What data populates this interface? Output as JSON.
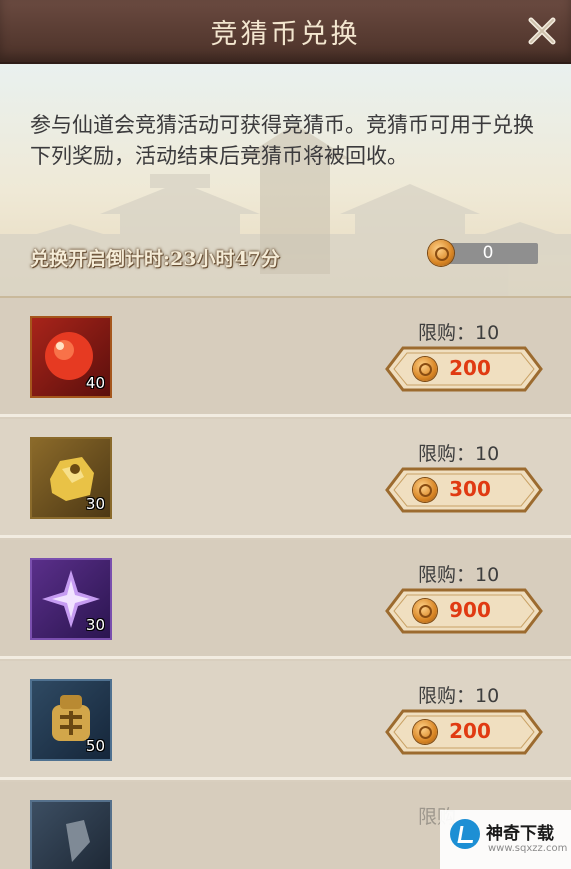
{
  "header": {
    "title": "竞猜币兑换"
  },
  "info": {
    "description": "参与仙道会竞猜活动可获得竞猜币。竞猜币可用于兑换下列奖励，活动结束后竞猜币将被回收。",
    "countdown": "兑换开启倒计时:23小时47分",
    "balance": "0"
  },
  "items": [
    {
      "icon": "red-orb-icon",
      "qty": "40",
      "limit": "限购：10",
      "price": "200"
    },
    {
      "icon": "gold-ore-icon",
      "qty": "30",
      "limit": "限购：10",
      "price": "300"
    },
    {
      "icon": "purple-star-icon",
      "qty": "30",
      "limit": "限购：10",
      "price": "900"
    },
    {
      "icon": "bronze-seal-icon",
      "qty": "50",
      "limit": "限购：10",
      "price": "200"
    },
    {
      "icon": "dark-item-icon",
      "qty": "",
      "limit": "限购",
      "price": ""
    }
  ],
  "watermark": {
    "name": "神奇下载",
    "url": "www.sqxzz.com"
  },
  "colors": {
    "titlebar": "#4b3128",
    "price": "#e03a12",
    "button": "#f0dfc0"
  }
}
